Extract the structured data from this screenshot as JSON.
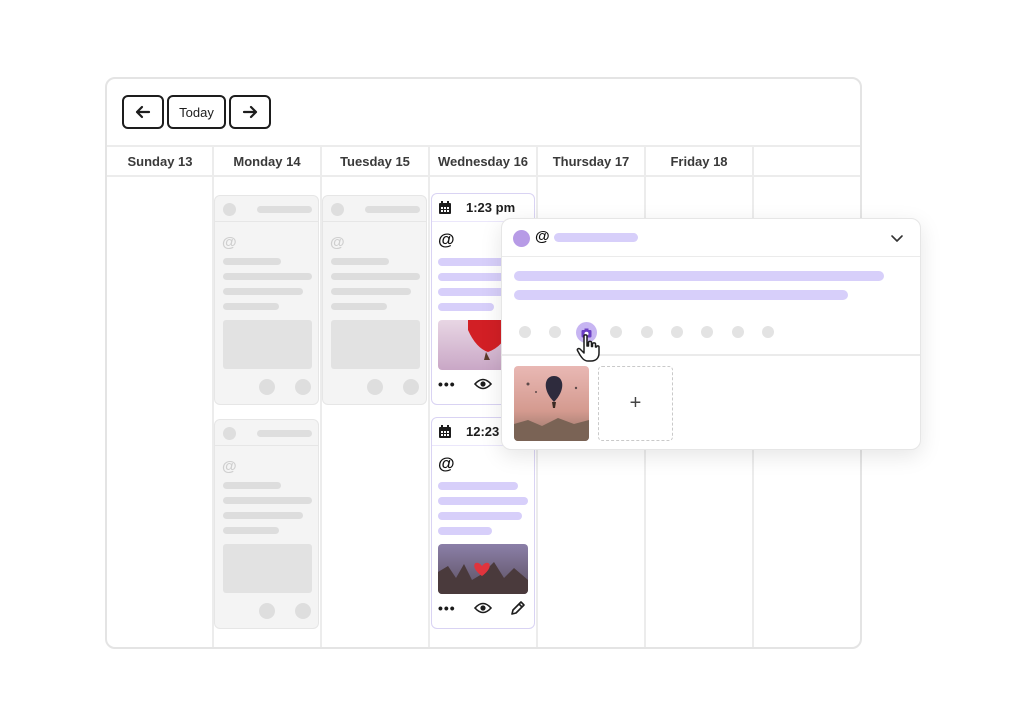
{
  "toolbar": {
    "prev_icon": "arrow-left-icon",
    "today_label": "Today",
    "next_icon": "arrow-right-icon"
  },
  "days": [
    "Sunday 13",
    "Monday 14",
    "Tuesday 15",
    "Wednesday 16",
    "Thursday 17",
    "Friday 18"
  ],
  "posts": [
    {
      "time": "1:23 pm",
      "platform_icon": "threads-icon",
      "image": "hot-air-balloon-photo"
    },
    {
      "time": "12:23",
      "platform_icon": "threads-icon",
      "image": "heart-balloon-photo"
    }
  ],
  "popover": {
    "platform_icon": "threads-icon",
    "add_label": "+",
    "media_icon": "camera-icon",
    "chevron_icon": "chevron-down-icon"
  },
  "colors": {
    "accent": "#d7cffa",
    "accent_strong": "#b79be6",
    "border": "#e4e4e4",
    "ghost": "#f4f4f4"
  }
}
